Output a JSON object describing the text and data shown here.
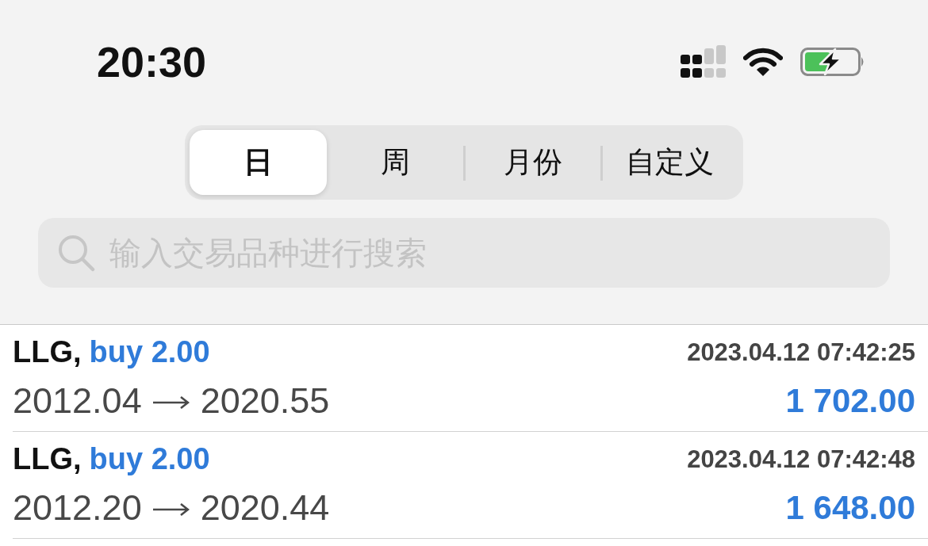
{
  "status_bar": {
    "time": "20:30"
  },
  "tabs": [
    {
      "label": "日",
      "selected": true
    },
    {
      "label": "周",
      "selected": false
    },
    {
      "label": "月份",
      "selected": false
    },
    {
      "label": "自定义",
      "selected": false
    }
  ],
  "search": {
    "placeholder": "输入交易品种进行搜索"
  },
  "trades": [
    {
      "symbol": "LLG,",
      "order": "buy 2.00",
      "time": "2023.04.12 07:42:25",
      "open_price": "2012.04",
      "close_price": "2020.55",
      "profit": "1 702.00"
    },
    {
      "symbol": "LLG,",
      "order": "buy 2.00",
      "time": "2023.04.12 07:42:48",
      "open_price": "2012.20",
      "close_price": "2020.44",
      "profit": "1 648.00"
    }
  ]
}
